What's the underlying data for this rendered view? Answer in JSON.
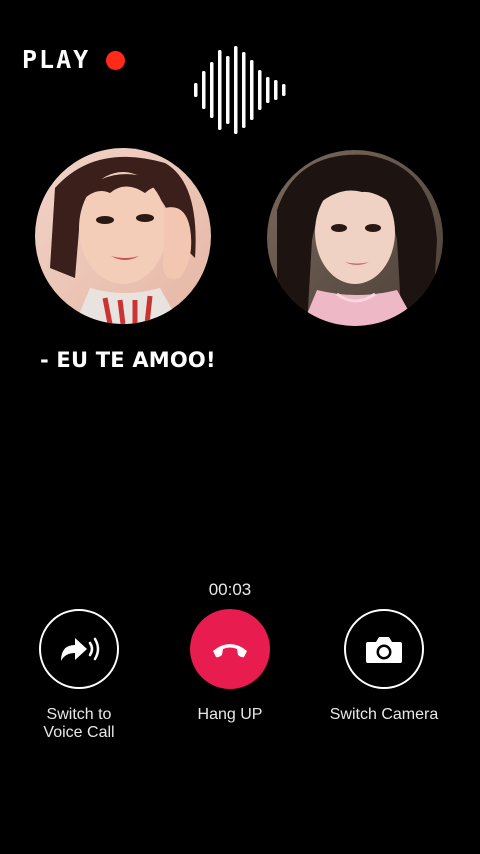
{
  "header": {
    "play_label": "PLAY",
    "record_dot_color": "#ff2a1a",
    "waveform_icon": "audio-waveform-icon"
  },
  "participants": [
    {
      "name": "",
      "avatar": "participant-left-photo"
    },
    {
      "name": "",
      "avatar": "participant-right-photo"
    }
  ],
  "caption": "- EU TE AMOO!",
  "call": {
    "timer": "00:03",
    "buttons": {
      "voice_line1": "Switch to",
      "voice_line2": "Voice Call",
      "hang_up": "Hang UP",
      "switch_camera": "Switch Camera"
    },
    "hang_color": "#e81c4f"
  },
  "icons": {
    "voice": "voice-call-forward-icon",
    "hang": "phone-hangup-icon",
    "camera": "camera-icon"
  }
}
